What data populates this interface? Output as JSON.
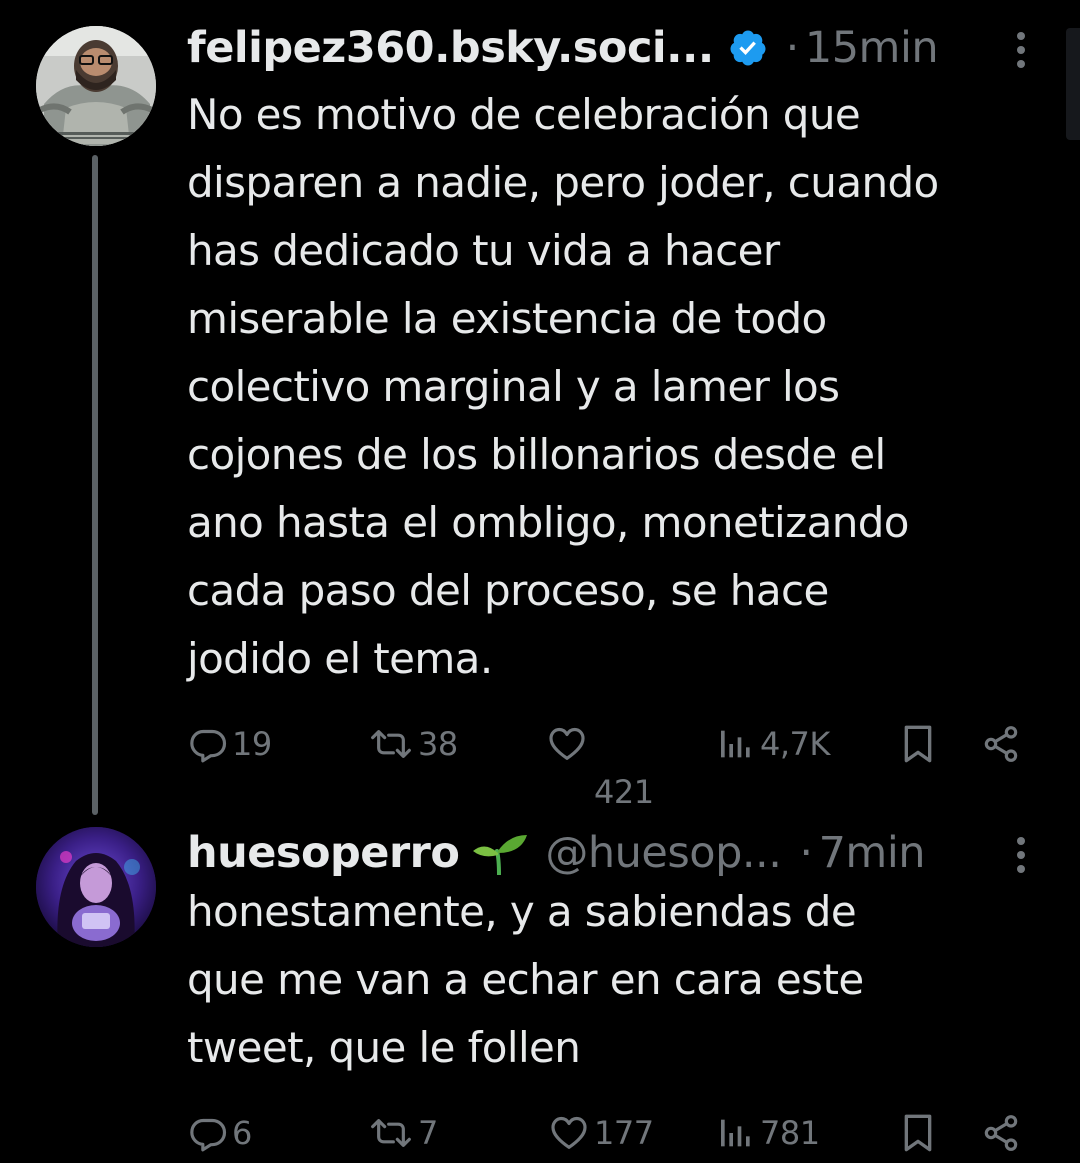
{
  "theme": {
    "background": "#000000",
    "text_primary": "#e7e9ea",
    "text_secondary": "#71767b",
    "verified_blue": "#1d9bf0",
    "thread_line": "#5b6165"
  },
  "tweets": [
    {
      "display_name": "felipez360.bsky.soci...",
      "handle": "",
      "verified": true,
      "badge_icon": "verified-badge-icon",
      "separator": "·",
      "time": "15min",
      "body_lines": [
        "No es motivo de celebración que",
        "disparen a nadie, pero joder, cuando",
        "has dedicado tu vida a hacer",
        "miserable la existencia de todo",
        "colectivo marginal y a lamer los",
        "cojones de los billonarios desde el",
        "ano hasta el ombligo, monetizando",
        "cada paso del proceso, se hace",
        "jodido el tema."
      ],
      "actions": {
        "replies": "19",
        "retweets": "38",
        "likes": "421",
        "views": "4,7K"
      }
    },
    {
      "display_name": "huesoperro",
      "handle": "@huesop...",
      "verified": false,
      "badge_icon": "sprout-emoji-icon",
      "separator": "·",
      "time": "7min",
      "body_lines": [
        "honestamente, y a sabiendas de",
        "que me van a echar en cara este",
        "tweet, que le follen"
      ],
      "actions": {
        "replies": "6",
        "retweets": "7",
        "likes": "177",
        "views": "781"
      }
    }
  ]
}
